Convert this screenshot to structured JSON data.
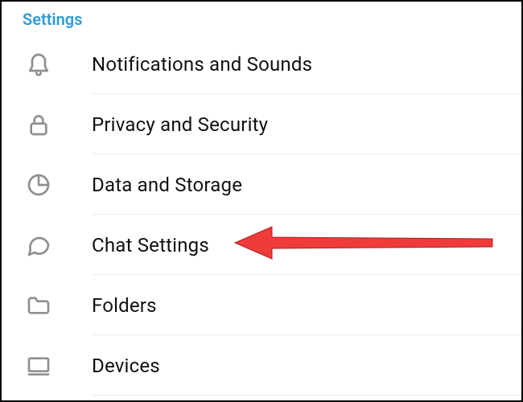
{
  "header": {
    "title": "Settings"
  },
  "items": [
    {
      "id": "notifications",
      "label": "Notifications and Sounds",
      "icon": "bell-icon"
    },
    {
      "id": "privacy",
      "label": "Privacy and Security",
      "icon": "lock-icon"
    },
    {
      "id": "data",
      "label": "Data and Storage",
      "icon": "pie-icon"
    },
    {
      "id": "chat",
      "label": "Chat Settings",
      "icon": "chat-icon"
    },
    {
      "id": "folders",
      "label": "Folders",
      "icon": "folder-icon"
    },
    {
      "id": "devices",
      "label": "Devices",
      "icon": "device-icon"
    }
  ],
  "annotation": {
    "target": "chat",
    "type": "arrow",
    "color": "#ef3b3a"
  }
}
